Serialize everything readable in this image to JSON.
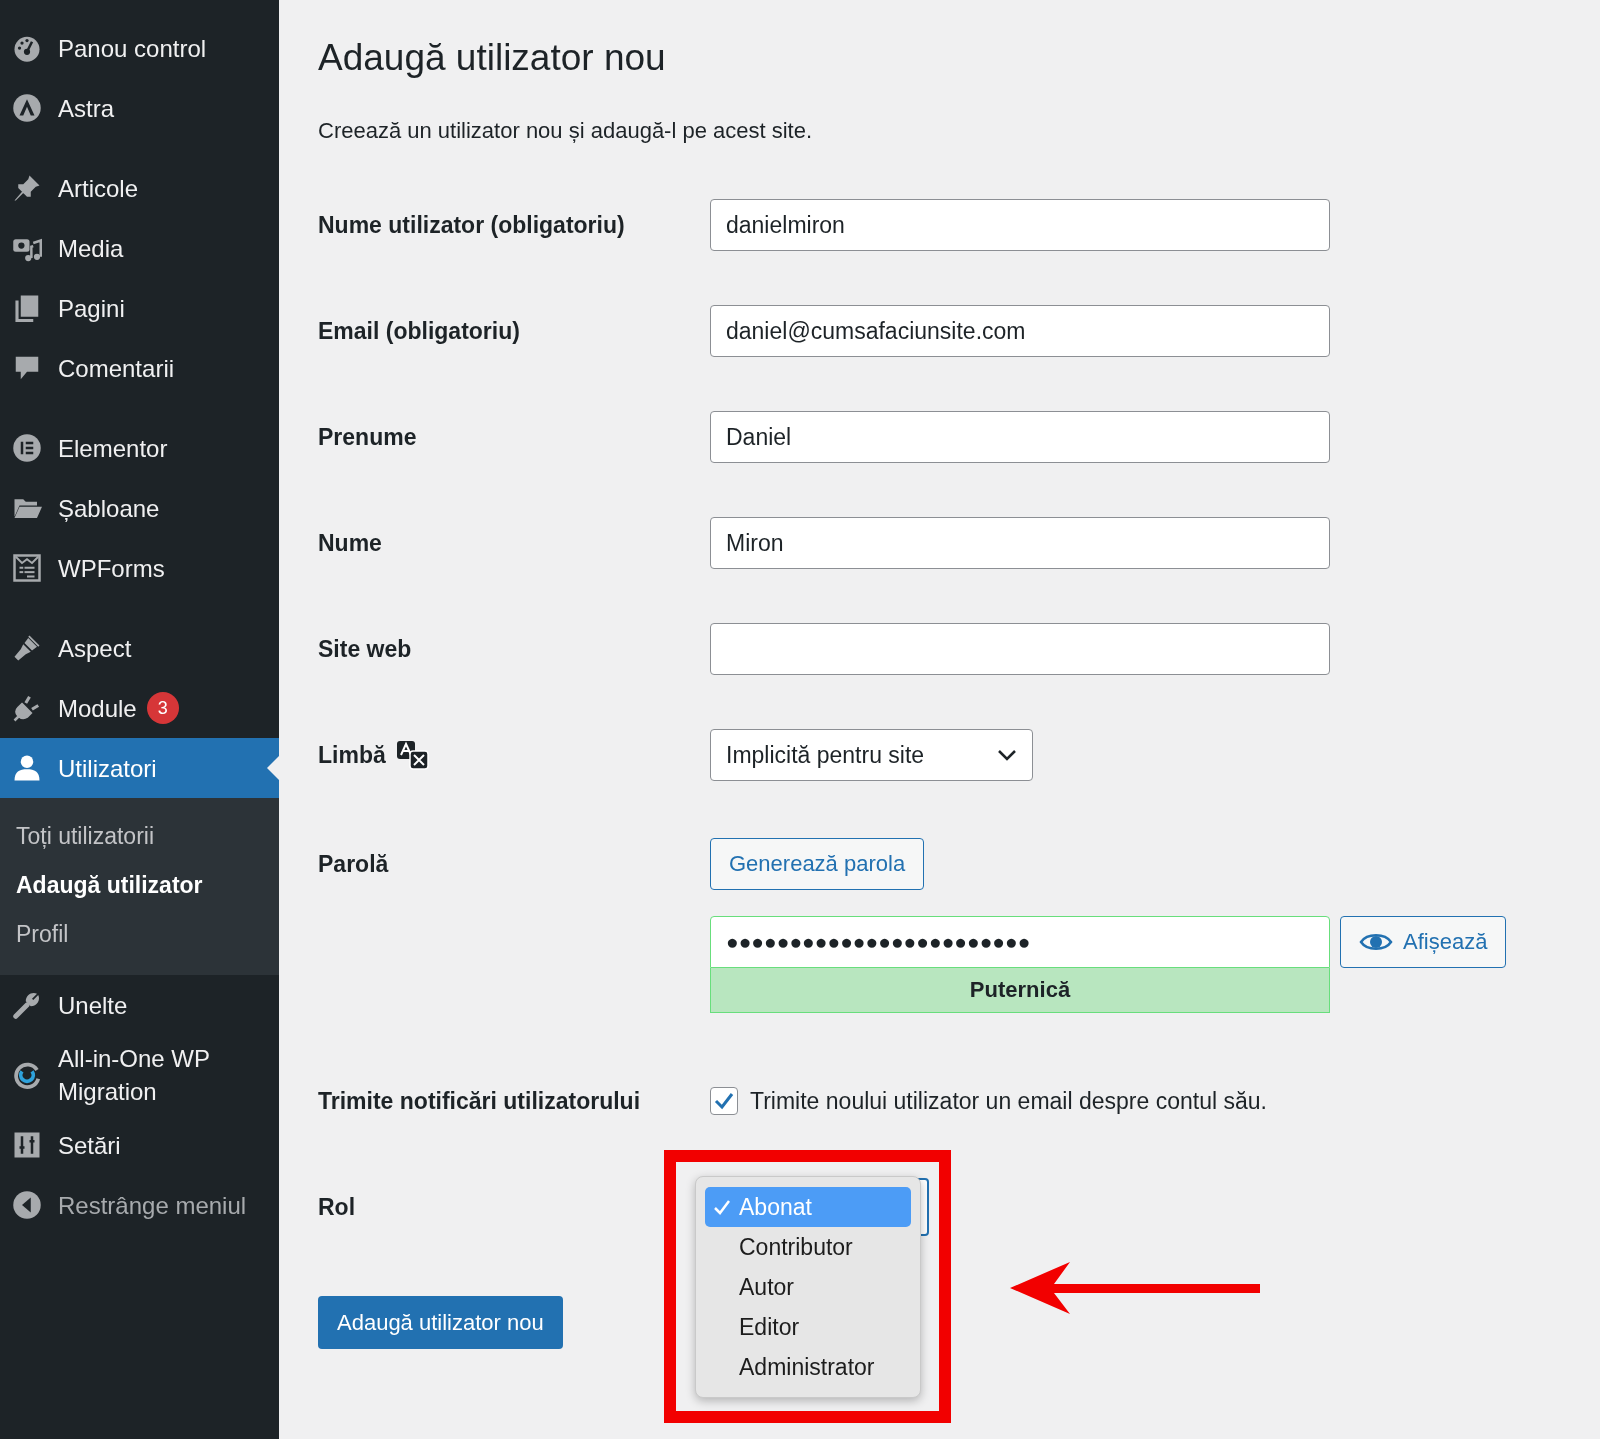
{
  "sidebar": {
    "groups": [
      [
        {
          "label": "Panou control",
          "selected": false
        },
        {
          "label": "Astra",
          "selected": false
        }
      ],
      [
        {
          "label": "Articole",
          "selected": false
        },
        {
          "label": "Media",
          "selected": false
        },
        {
          "label": "Pagini",
          "selected": false
        },
        {
          "label": "Comentarii",
          "selected": false
        }
      ],
      [
        {
          "label": "Elementor",
          "selected": false
        },
        {
          "label": "Șabloane",
          "selected": false
        },
        {
          "label": "WPForms",
          "selected": false
        }
      ],
      [
        {
          "label": "Aspect",
          "selected": false
        },
        {
          "label": "Module",
          "selected": false,
          "badge": "3"
        },
        {
          "label": "Utilizatori",
          "selected": true,
          "children": [
            {
              "label": "Toți utilizatorii",
              "selected": false
            },
            {
              "label": "Adaugă utilizator",
              "selected": true
            },
            {
              "label": "Profil",
              "selected": false
            }
          ]
        },
        {
          "label": "Unelte",
          "selected": false
        },
        {
          "label": "All-in-One WP Migration",
          "selected": false
        },
        {
          "label": "Setări",
          "selected": false
        },
        {
          "label": "Restrânge meniul",
          "selected": false,
          "kind": "collapse"
        }
      ]
    ]
  },
  "page": {
    "title": "Adaugă utilizator nou",
    "description": "Creează un utilizator nou și adaugă-l pe acest site."
  },
  "form": {
    "fields": [
      {
        "kind": "text",
        "label": "Nume utilizator (obligatoriu)",
        "value": "danielmiron"
      },
      {
        "kind": "text",
        "label": "Email (obligatoriu)",
        "value": "daniel@cumsafaciunsite.com"
      },
      {
        "kind": "text",
        "label": "Prenume",
        "value": "Daniel"
      },
      {
        "kind": "text",
        "label": "Nume",
        "value": "Miron"
      },
      {
        "kind": "text",
        "label": "Site web"
      },
      {
        "kind": "select",
        "label": "Limbă",
        "value": "Implicită pentru site"
      },
      {
        "kind": "password",
        "label": "Parolă",
        "generate_button": "Generează parola",
        "value": "●●●●●●●●●●●●●●●●●●●●●●●●",
        "show_button": "Afișează",
        "strength": "Puternică"
      },
      {
        "kind": "checkbox",
        "label": "Trimite notificări utilizatorului",
        "text": "Trimite noului utilizator un email despre contul său.",
        "checked": true
      },
      {
        "kind": "role",
        "label": "Rol",
        "options": [
          {
            "label": "Abonat",
            "selected": true
          },
          {
            "label": "Contributor",
            "selected": false
          },
          {
            "label": "Autor",
            "selected": false
          },
          {
            "label": "Editor",
            "selected": false
          },
          {
            "label": "Administrator",
            "selected": false
          }
        ]
      }
    ],
    "submit_button": "Adaugă utilizator nou"
  }
}
